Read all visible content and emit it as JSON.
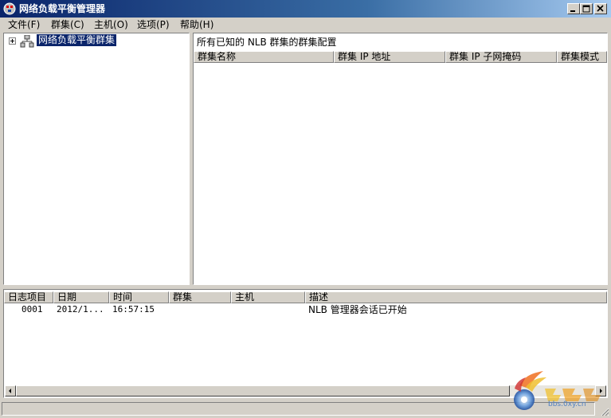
{
  "window": {
    "title": "网络负载平衡管理器",
    "icon": "nlb-manager-icon"
  },
  "menu": [
    {
      "label": "文件(F)"
    },
    {
      "label": "群集(C)"
    },
    {
      "label": "主机(O)"
    },
    {
      "label": "选项(P)"
    },
    {
      "label": "帮助(H)"
    }
  ],
  "tree": {
    "root_label": "网络负载平衡群集",
    "root_icon": "cluster-network-icon",
    "expanded": false
  },
  "right_panel": {
    "title": "所有已知的 NLB 群集的群集配置",
    "columns": [
      "群集名称",
      "群集 IP 地址",
      "群集 IP 子网掩码",
      "群集模式"
    ],
    "rows": []
  },
  "log": {
    "columns": [
      "日志项目",
      "日期",
      "时间",
      "群集",
      "主机",
      "描述"
    ],
    "rows": [
      {
        "entry": "0001",
        "date": "2012/1...",
        "time": "16:57:15",
        "cluster": "",
        "host": "",
        "description": "NLB 管理器会话已开始"
      }
    ]
  },
  "watermark": {
    "site": "bbs.0xy.cn"
  },
  "colors": {
    "titlebar_start": "#0a246a",
    "titlebar_end": "#a6caf0",
    "chrome": "#d4d0c8",
    "selection": "#0a246a"
  }
}
